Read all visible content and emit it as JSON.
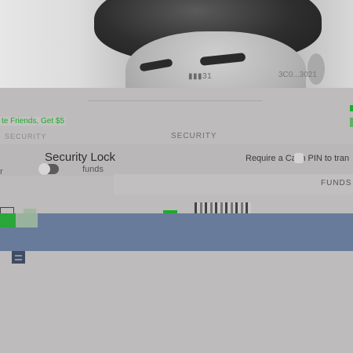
{
  "photo": {
    "overlay_left": "▮▮▮31",
    "overlay_right": "3C0...3021"
  },
  "promo": {
    "invite_text": "te Friends, Get $5"
  },
  "section": {
    "left_header": "SECURITY",
    "right_header": "SECURITY",
    "left_char": "r"
  },
  "security_lock": {
    "label": "Security Lock",
    "sublabel": "funds",
    "enabled": false
  },
  "require_pin": {
    "label": "Require a Cash PIN to tran"
  },
  "funds_header": "FUNDS",
  "colors": {
    "accent_green": "#1faa2c",
    "nav_blue": "#687b9b",
    "background": "#bdbbbb"
  },
  "icons": {
    "menu": "menu-icon",
    "toggle": "toggle-switch"
  }
}
